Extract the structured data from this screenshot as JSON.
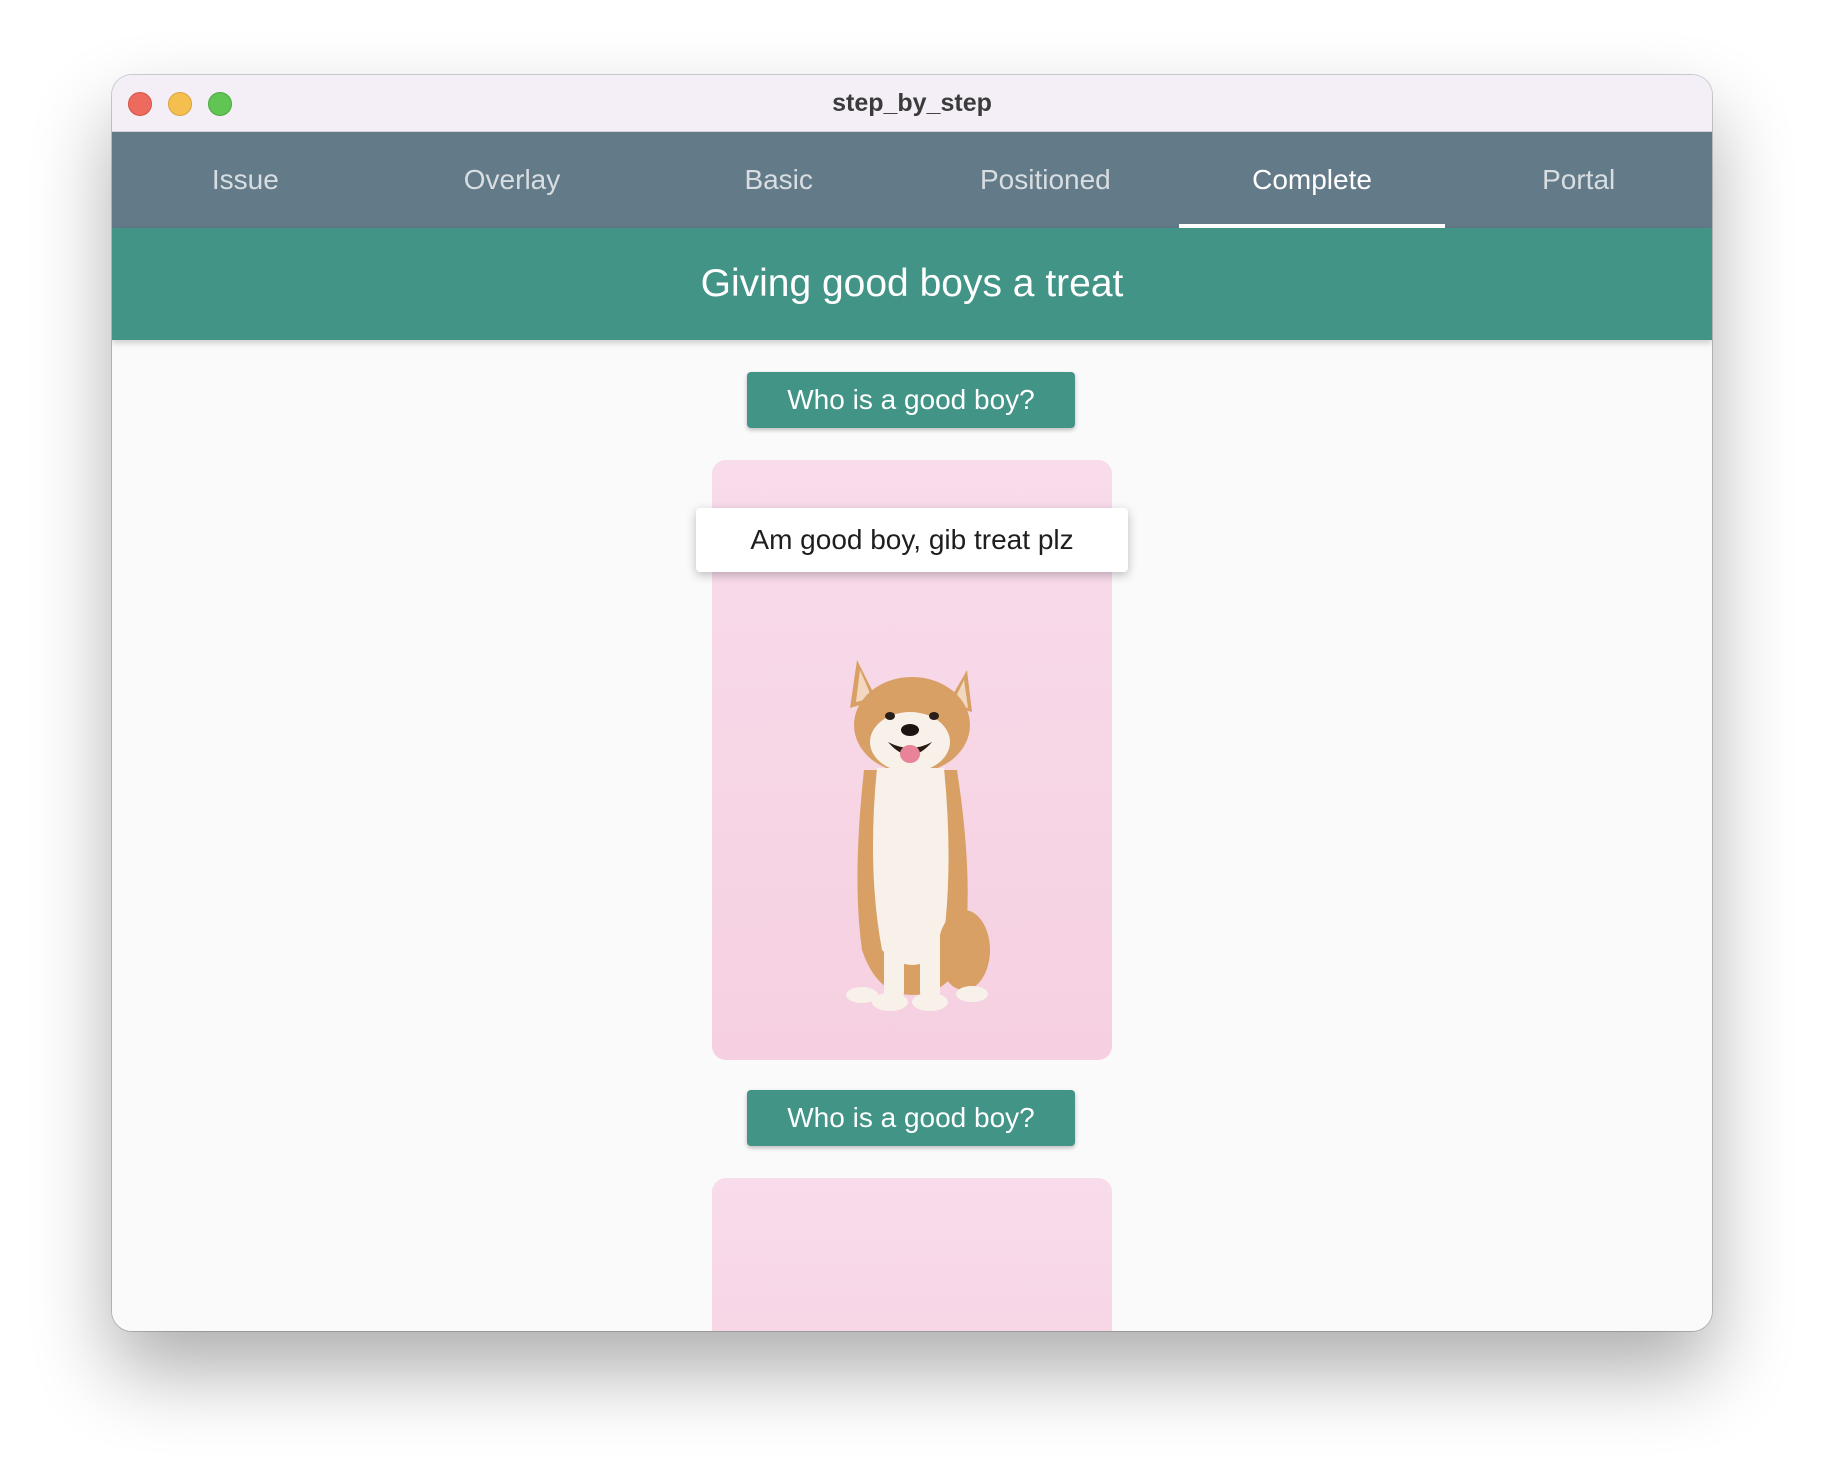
{
  "window": {
    "title": "step_by_step"
  },
  "tabs": [
    {
      "label": "Issue",
      "active": false
    },
    {
      "label": "Overlay",
      "active": false
    },
    {
      "label": "Basic",
      "active": false
    },
    {
      "label": "Positioned",
      "active": false
    },
    {
      "label": "Complete",
      "active": true
    },
    {
      "label": "Portal",
      "active": false
    }
  ],
  "appbar": {
    "title": "Giving good boys a treat"
  },
  "items": [
    {
      "button_label": "Who is a good boy?",
      "tooltip_text": "Am good boy, gib treat plz",
      "image": "shiba-inu-dog-photo"
    },
    {
      "button_label": "Who is a good boy?",
      "image": "shiba-inu-dog-photo"
    }
  ],
  "colors": {
    "tabbar": "#637a88",
    "accent": "#429486",
    "card_background": "#f6d0e0"
  }
}
